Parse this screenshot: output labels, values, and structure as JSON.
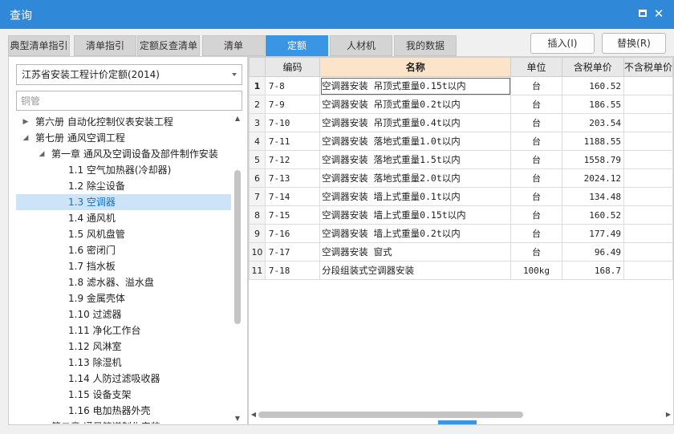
{
  "window": {
    "title": "查询"
  },
  "tabs": [
    {
      "label": "典型清单指引",
      "active": false
    },
    {
      "label": "清单指引",
      "active": false
    },
    {
      "label": "定额反查清单",
      "active": false
    },
    {
      "label": "清单",
      "active": false
    },
    {
      "label": "定额",
      "active": true
    },
    {
      "label": "人材机",
      "active": false
    },
    {
      "label": "我的数据",
      "active": false
    }
  ],
  "actions": {
    "insert": "插入(I)",
    "replace": "替换(R)"
  },
  "library": {
    "selected": "江苏省安装工程计价定额(2014)"
  },
  "search": {
    "value": "",
    "placeholder": "铜管"
  },
  "tree": [
    {
      "label": "第六册 自动化控制仪表安装工程",
      "arrow": "▶"
    },
    {
      "label": "第七册 通风空调工程",
      "arrow": "◢"
    },
    {
      "label": "第一章 通风及空调设备及部件制作安装",
      "arrow": "◢"
    },
    {
      "label": "1.1 空气加热器(冷却器)",
      "arrow": ""
    },
    {
      "label": "1.2 除尘设备",
      "arrow": ""
    },
    {
      "label": "1.3 空调器",
      "arrow": "",
      "selected": true
    },
    {
      "label": "1.4 通风机",
      "arrow": ""
    },
    {
      "label": "1.5 风机盘管",
      "arrow": ""
    },
    {
      "label": "1.6 密闭门",
      "arrow": ""
    },
    {
      "label": "1.7 挡水板",
      "arrow": ""
    },
    {
      "label": "1.8 滤水器、溢水盘",
      "arrow": ""
    },
    {
      "label": "1.9 金属壳体",
      "arrow": ""
    },
    {
      "label": "1.10 过滤器",
      "arrow": ""
    },
    {
      "label": "1.11 净化工作台",
      "arrow": ""
    },
    {
      "label": "1.12 风淋室",
      "arrow": ""
    },
    {
      "label": "1.13 除湿机",
      "arrow": ""
    },
    {
      "label": "1.14 人防过滤吸收器",
      "arrow": ""
    },
    {
      "label": "1.15 设备支架",
      "arrow": ""
    },
    {
      "label": "1.16 电加热器外壳",
      "arrow": ""
    },
    {
      "label": "第二章 通风管道制作安装",
      "arrow": "▶"
    }
  ],
  "table": {
    "headers": {
      "code": "编码",
      "name": "名称",
      "unit": "单位",
      "price_tax": "含税单价",
      "price_notax": "不含税单价"
    },
    "rows": [
      {
        "no": "1",
        "code": "7-8",
        "name": "空调器安装 吊顶式重量0.15t以内",
        "unit": "台",
        "price": "160.52"
      },
      {
        "no": "2",
        "code": "7-9",
        "name": "空调器安装 吊顶式重量0.2t以内",
        "unit": "台",
        "price": "186.55"
      },
      {
        "no": "3",
        "code": "7-10",
        "name": "空调器安装 吊顶式重量0.4t以内",
        "unit": "台",
        "price": "203.54"
      },
      {
        "no": "4",
        "code": "7-11",
        "name": "空调器安装 落地式重量1.0t以内",
        "unit": "台",
        "price": "1188.55"
      },
      {
        "no": "5",
        "code": "7-12",
        "name": "空调器安装 落地式重量1.5t以内",
        "unit": "台",
        "price": "1558.79"
      },
      {
        "no": "6",
        "code": "7-13",
        "name": "空调器安装 落地式重量2.0t以内",
        "unit": "台",
        "price": "2024.12"
      },
      {
        "no": "7",
        "code": "7-14",
        "name": "空调器安装 墙上式重量0.1t以内",
        "unit": "台",
        "price": "134.48"
      },
      {
        "no": "8",
        "code": "7-15",
        "name": "空调器安装 墙上式重量0.15t以内",
        "unit": "台",
        "price": "160.52"
      },
      {
        "no": "9",
        "code": "7-16",
        "name": "空调器安装 墙上式重量0.2t以内",
        "unit": "台",
        "price": "177.49"
      },
      {
        "no": "10",
        "code": "7-17",
        "name": "空调器安装 窗式",
        "unit": "台",
        "price": "96.49"
      },
      {
        "no": "11",
        "code": "7-18",
        "name": "分段组装式空调器安装",
        "unit": "100kg",
        "price": "168.7"
      }
    ]
  },
  "colors": {
    "titlebar": "#2f88d8",
    "active_tab": "#3a95e4",
    "selected_tree": "#cde4f7",
    "name_header": "#fbe4c9"
  }
}
